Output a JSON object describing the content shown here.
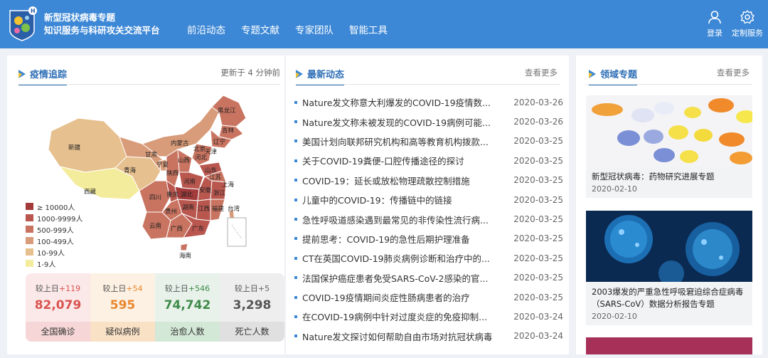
{
  "header": {
    "title_line1": "新型冠状病毒专题",
    "title_line2": "知识服务与科研攻关交流平台",
    "nav": [
      "前沿动态",
      "专题文献",
      "专家团队",
      "智能工具"
    ],
    "login": "登录",
    "custom_service": "定制服务",
    "brand_color": "#3d88d6"
  },
  "epidemic": {
    "title": "疫情追踪",
    "updated": "更新于 4 分钟前",
    "map_labels": [
      "新疆",
      "西藏",
      "青海",
      "甘肃",
      "内蒙古",
      "黑龙江",
      "吉林",
      "辽宁",
      "宁夏",
      "陕西",
      "山西",
      "河北",
      "北京",
      "天津",
      "山东",
      "河南",
      "四川",
      "重庆",
      "湖北",
      "安徽",
      "江苏",
      "上海",
      "浙江",
      "贵州",
      "湖南",
      "江西",
      "福建",
      "云南",
      "广西",
      "广东",
      "海南",
      "台湾"
    ],
    "legend": [
      {
        "label": "≥ 10000人",
        "color": "#a33b3b"
      },
      {
        "label": "1000-9999人",
        "color": "#b9574f"
      },
      {
        "label": "500-999人",
        "color": "#c97461"
      },
      {
        "label": "100-499人",
        "color": "#d99c7a"
      },
      {
        "label": "10-99人",
        "color": "#e6c08e"
      },
      {
        "label": "1-9人",
        "color": "#f4ec9d"
      }
    ],
    "stats": [
      {
        "compare": "较上日",
        "delta": "+119",
        "value": "82,079",
        "label": "全国确诊",
        "bg": "#fbe9e9",
        "lbl_bg": "#f6d6d6",
        "val_color": "#d9534f",
        "delta_color": "#d9534f"
      },
      {
        "compare": "较上日",
        "delta": "+54",
        "value": "595",
        "label": "疑似病例",
        "bg": "#fdf1e3",
        "lbl_bg": "#f9e1c5",
        "val_color": "#e8872e",
        "delta_color": "#e8872e"
      },
      {
        "compare": "较上日",
        "delta": "+546",
        "value": "74,742",
        "label": "治愈人数",
        "bg": "#e8f2ea",
        "lbl_bg": "#d3e8d6",
        "val_color": "#3f8a4a",
        "delta_color": "#3f8a4a"
      },
      {
        "compare": "较上日",
        "delta": "+5",
        "value": "3,298",
        "label": "死亡人数",
        "bg": "#eeeeee",
        "lbl_bg": "#e0e0e0",
        "val_color": "#555555",
        "delta_color": "#666666"
      }
    ]
  },
  "news": {
    "title": "最新动态",
    "more": "查看更多",
    "items": [
      {
        "title": "Nature发文称意大利爆发的COVID-19疫情数...",
        "date": "2020-03-26"
      },
      {
        "title": "Nature发文称未被发现的COVID-19病例可能...",
        "date": "2020-03-26"
      },
      {
        "title": "美国计划向联邦研究机构和高等教育机构拨款...",
        "date": "2020-03-25"
      },
      {
        "title": "关于COVID-19粪便-口腔传播途径的探讨",
        "date": "2020-03-25"
      },
      {
        "title": "COVID-19：延长或放松物理疏散控制措施",
        "date": "2020-03-25"
      },
      {
        "title": "儿童中的COVID-19：传播链中的链接",
        "date": "2020-03-25"
      },
      {
        "title": "急性呼吸道感染遇到最常见的非传染性流行病...",
        "date": "2020-03-25"
      },
      {
        "title": "提前思考：COVID-19的急性后期护理准备",
        "date": "2020-03-25"
      },
      {
        "title": "CT在英国COVID-19肺炎病例诊断和治疗中的...",
        "date": "2020-03-25"
      },
      {
        "title": "法国保护癌症患者免受SARS-CoV-2感染的官...",
        "date": "2020-03-25"
      },
      {
        "title": "COVID-19疫情期间炎症性肠病患者的治疗",
        "date": "2020-03-25"
      },
      {
        "title": "在COVID-19病例中针对过度炎症的免疫抑制...",
        "date": "2020-03-24"
      },
      {
        "title": "Nature发文探讨如何帮助自由市场对抗冠状病毒",
        "date": "2020-03-24"
      }
    ]
  },
  "topics": {
    "title": "领域专题",
    "more": "查看更多",
    "items": [
      {
        "title": "新型冠状病毒：药物研究进展专题",
        "date": "2020-02-10",
        "image": "pills-image"
      },
      {
        "title": "2003爆发的严重急性呼吸窘迫综合症病毒（SARS-CoV）数据分析报告专题",
        "date": "2020-02-10",
        "image": "virus-image"
      }
    ]
  }
}
